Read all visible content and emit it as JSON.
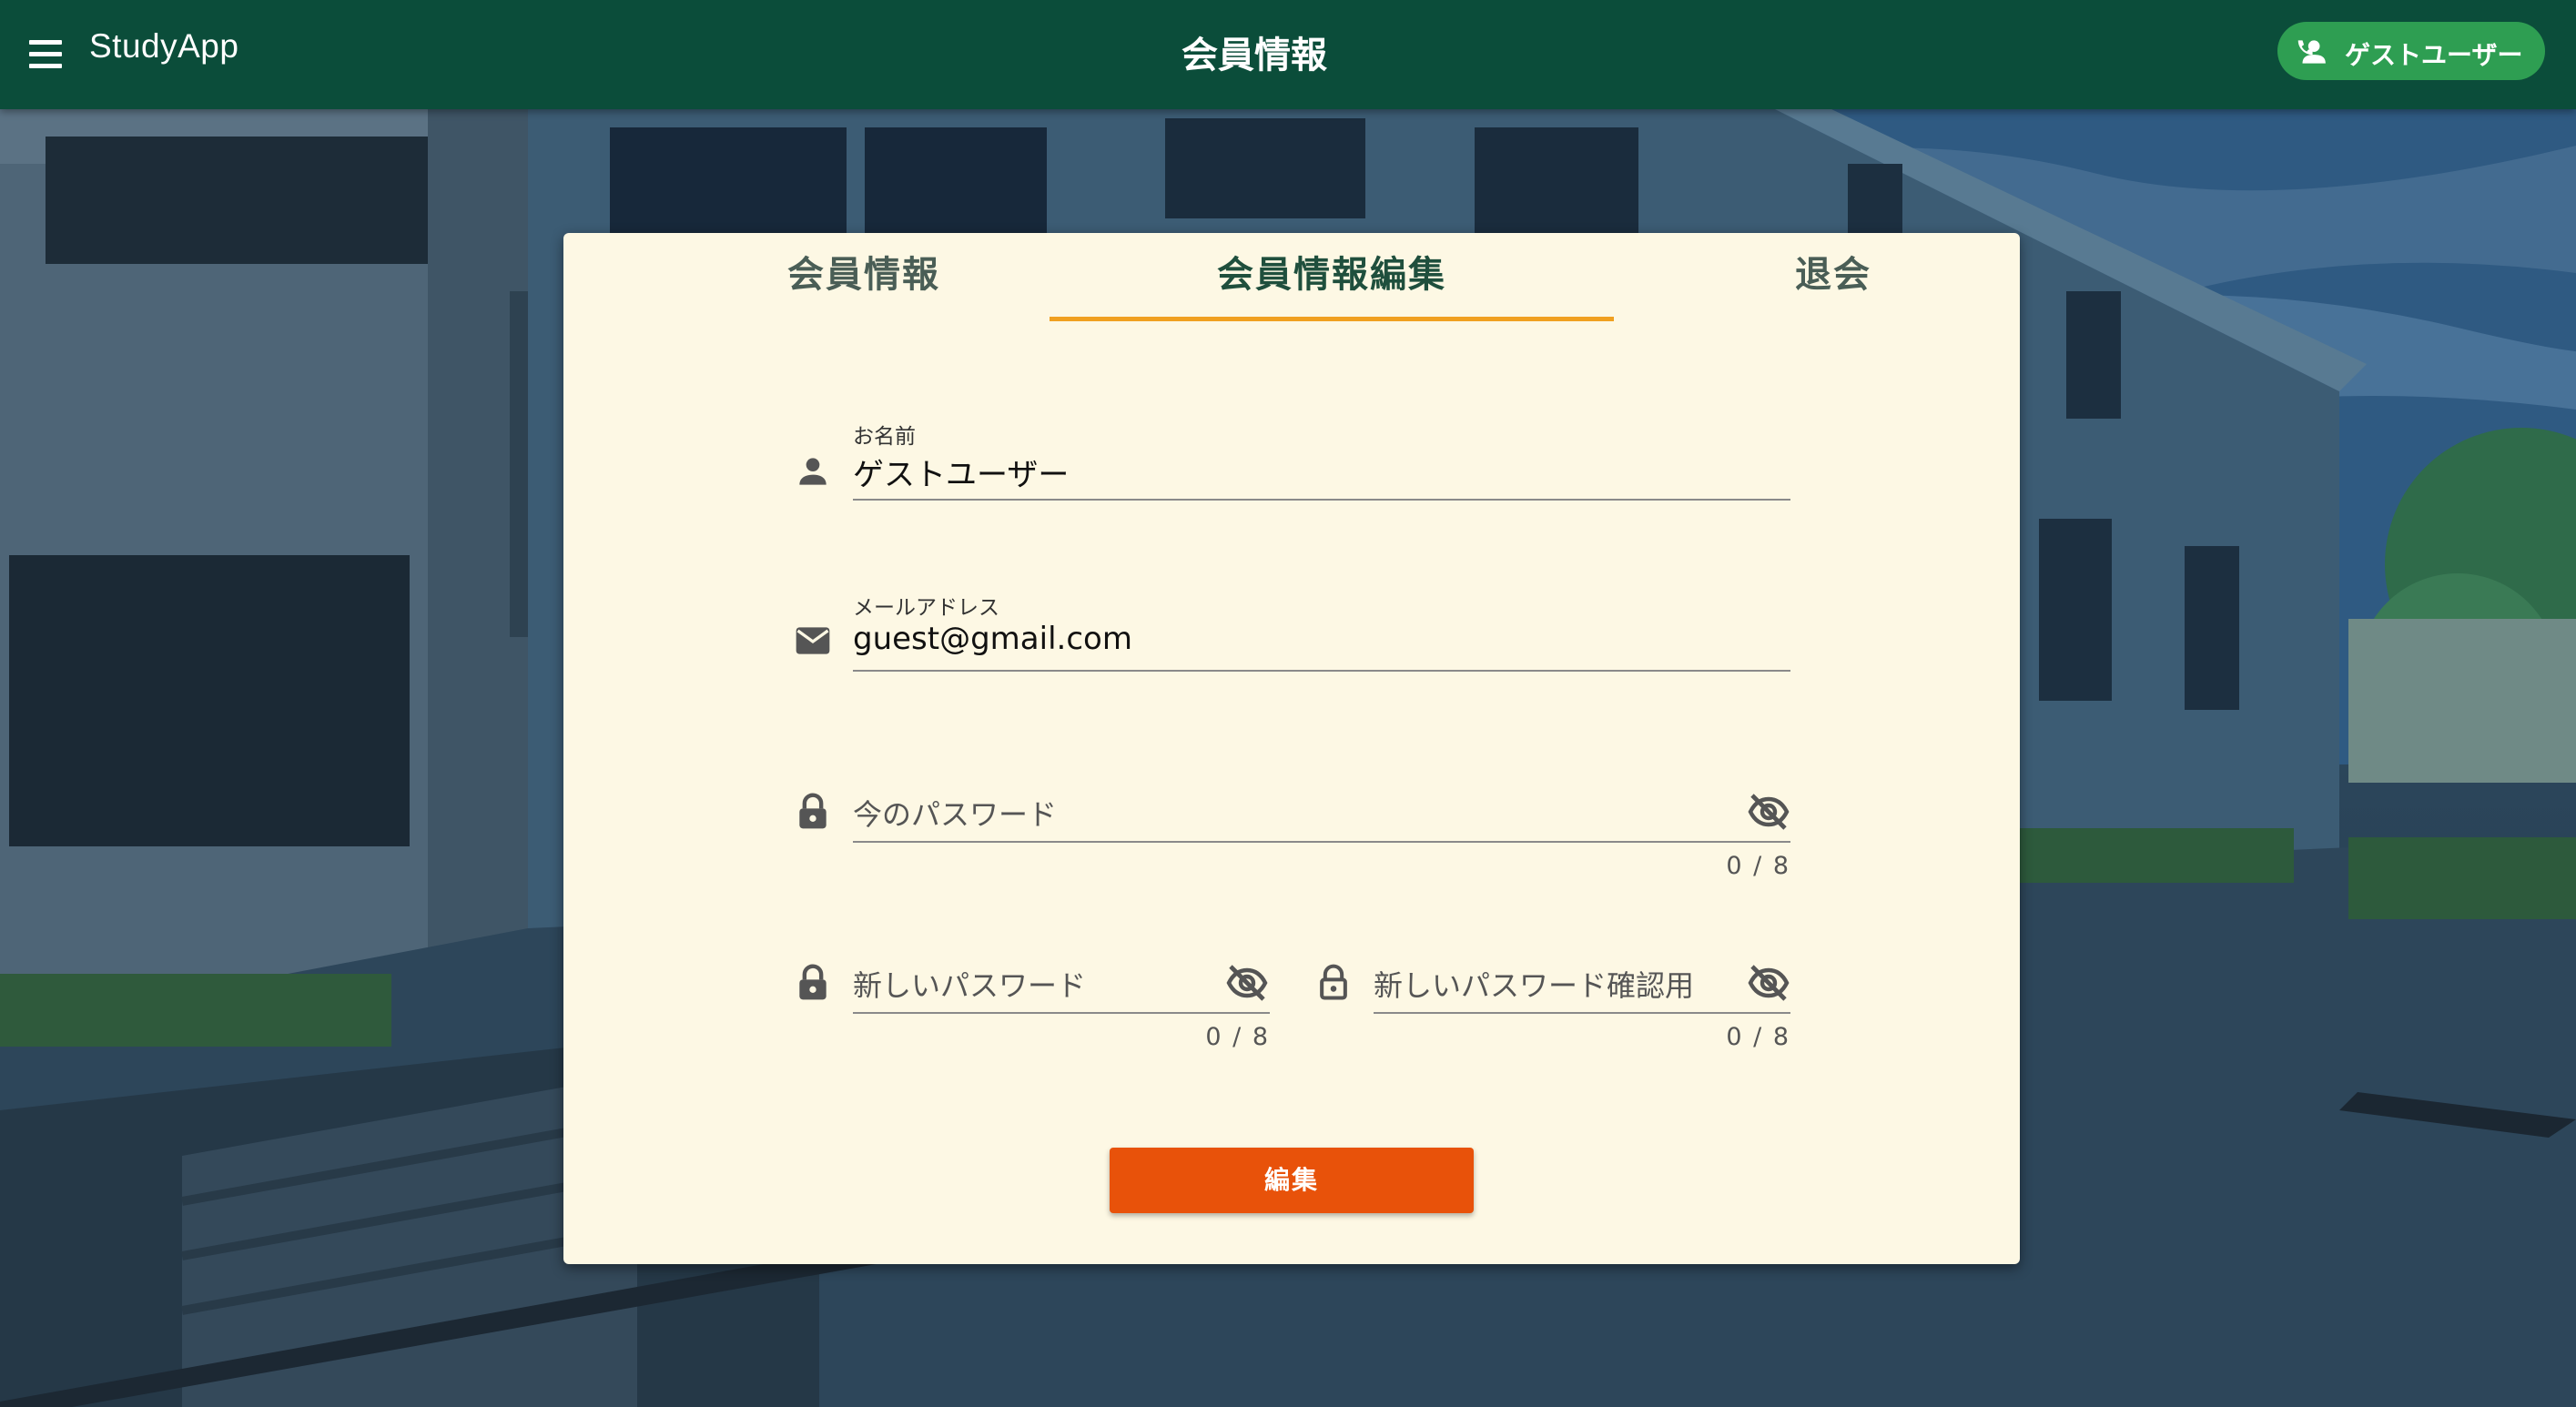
{
  "app_bar": {
    "app_name": "StudyApp",
    "page_title": "会員情報",
    "user_button_label": "ゲストユーザー",
    "color": "#0b4d3a",
    "user_button_color": "#2e9e52"
  },
  "tabs": [
    {
      "label": "会員情報",
      "active": false
    },
    {
      "label": "会員情報編集",
      "active": true
    },
    {
      "label": "退会",
      "active": false
    }
  ],
  "form": {
    "name": {
      "label": "お名前",
      "value": "ゲストユーザー",
      "icon": "person-icon"
    },
    "email": {
      "label": "メールアドレス",
      "value": "guest@gmail.com",
      "icon": "mail-icon"
    },
    "current_password": {
      "placeholder": "今のパスワード",
      "counter": "0 / 8",
      "icon": "lock-icon",
      "toggle_icon": "eye-off-icon"
    },
    "new_password": {
      "placeholder": "新しいパスワード",
      "counter": "0 / 8",
      "icon": "lock-icon",
      "toggle_icon": "eye-off-icon"
    },
    "new_password_confirm": {
      "placeholder": "新しいパスワード確認用",
      "counter": "0 / 8",
      "icon": "lock-open-icon",
      "toggle_icon": "eye-off-icon"
    },
    "submit_label": "編集"
  },
  "colors": {
    "card_background": "#fdf8e4",
    "tab_indicator": "#f0a020",
    "submit_button": "#e8520a"
  }
}
